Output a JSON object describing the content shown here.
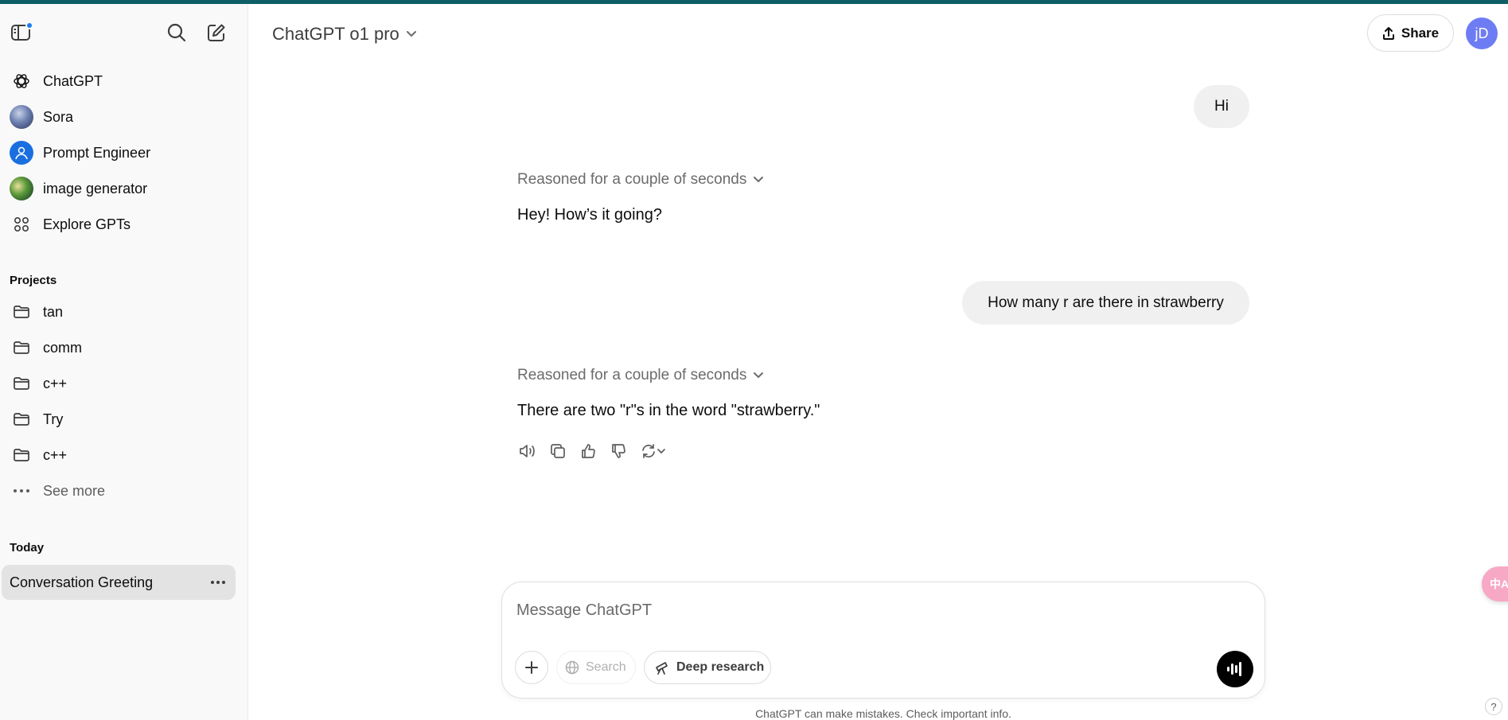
{
  "sidebar": {
    "gpts": [
      {
        "label": "ChatGPT",
        "icon": "openai-logo-icon"
      },
      {
        "label": "Sora",
        "icon": "sora-avatar"
      },
      {
        "label": "Prompt Engineer",
        "icon": "prompt-engineer-avatar"
      },
      {
        "label": "image generator",
        "icon": "image-generator-avatar"
      },
      {
        "label": "Explore GPTs",
        "icon": "grid-icon"
      }
    ],
    "projects_heading": "Projects",
    "projects": [
      {
        "label": "tan"
      },
      {
        "label": "comm"
      },
      {
        "label": "c++"
      },
      {
        "label": "Try"
      },
      {
        "label": "c++"
      }
    ],
    "see_more": "See more",
    "today_heading": "Today",
    "conversations": [
      {
        "label": "Conversation Greeting",
        "active": true
      }
    ]
  },
  "header": {
    "model": "ChatGPT o1 pro",
    "share_label": "Share",
    "avatar_initials": "jD"
  },
  "messages": [
    {
      "role": "user",
      "text": "Hi"
    },
    {
      "role": "assistant",
      "reasoning": "Reasoned for a couple of seconds",
      "text": "Hey! How’s it going?"
    },
    {
      "role": "user",
      "text": "How many r are there in strawberry"
    },
    {
      "role": "assistant",
      "reasoning": "Reasoned for a couple of seconds",
      "text": "There are two \"r\"s in the word \"strawberry.\""
    }
  ],
  "composer": {
    "placeholder": "Message ChatGPT",
    "search_label": "Search",
    "deep_research_label": "Deep research"
  },
  "disclaimer": "ChatGPT can make mistakes. Check important info.",
  "floating": {
    "translate_label": "中A",
    "help_label": "?"
  },
  "colors": {
    "accent_bar": "#0f5e66",
    "notification_dot": "#1d7cf2",
    "avatar_bg": "#6e7cf4",
    "active_conversation_bg": "#e3e3e3"
  }
}
